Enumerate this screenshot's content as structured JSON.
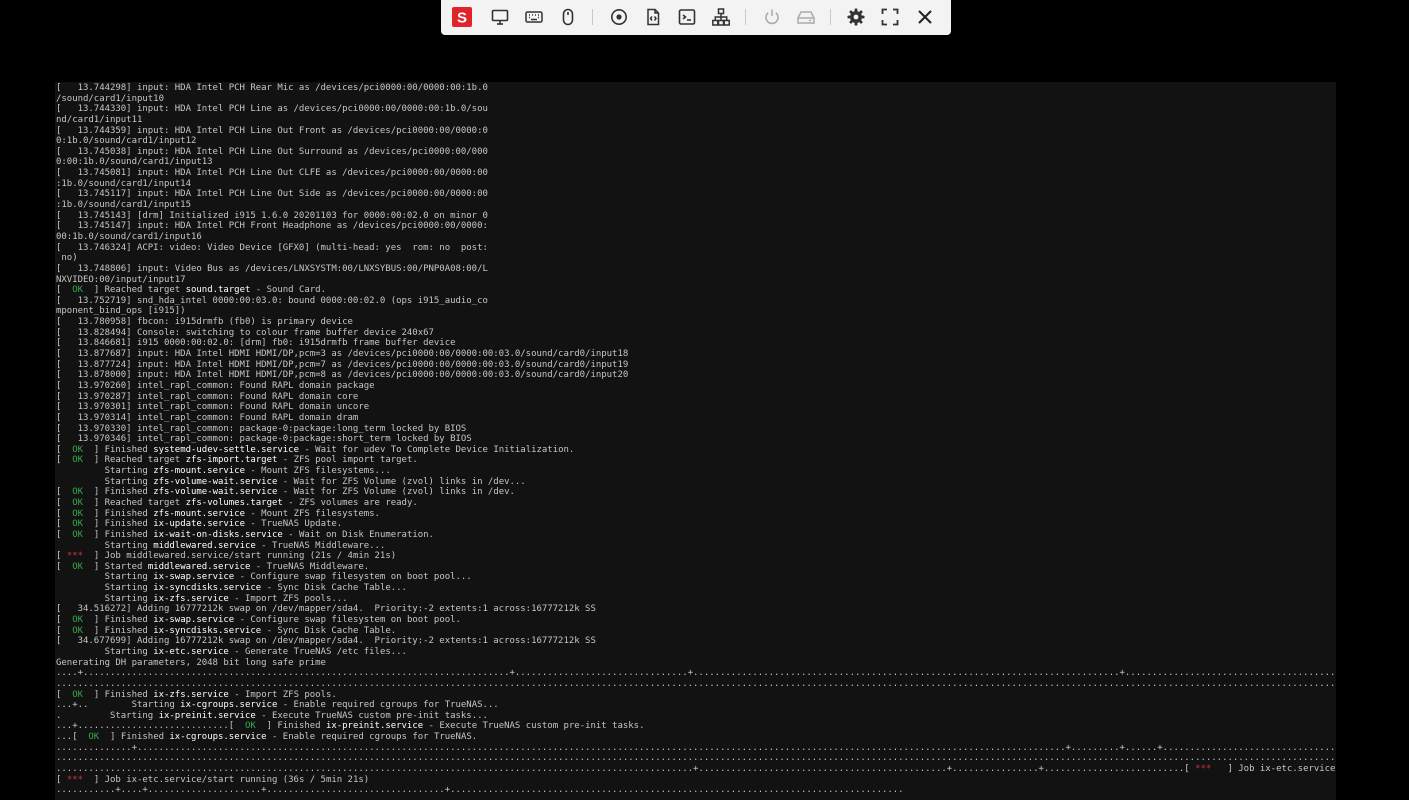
{
  "toolbar": {
    "logo_letter": "S",
    "brand_color": "#e0242b",
    "buttons": [
      {
        "name": "display-icon"
      },
      {
        "name": "keyboard-icon"
      },
      {
        "name": "mouse-icon"
      },
      {
        "name": "disc-icon"
      },
      {
        "name": "script-icon"
      },
      {
        "name": "terminal-icon"
      },
      {
        "name": "network-icon"
      },
      {
        "name": "power-icon"
      },
      {
        "name": "drive-icon"
      },
      {
        "name": "gear-icon"
      },
      {
        "name": "fullscreen-icon"
      },
      {
        "name": "close-icon"
      }
    ]
  },
  "console": {
    "colors": {
      "background": "#121212",
      "text": "#c6c6c6",
      "ok": "#35a84a",
      "star": "#c53a3a",
      "highlight": "#ffffff"
    },
    "lines": [
      [
        [
          "t",
          "[   13.744298] input: HDA Intel PCH Rear Mic as /devices/pci0000:00/0000:00:1b.0"
        ]
      ],
      [
        [
          "t",
          "/sound/card1/input10"
        ]
      ],
      [
        [
          "t",
          "[   13.744330] input: HDA Intel PCH Line as /devices/pci0000:00/0000:00:1b.0/sou"
        ]
      ],
      [
        [
          "t",
          "nd/card1/input11"
        ]
      ],
      [
        [
          "t",
          "[   13.744359] input: HDA Intel PCH Line Out Front as /devices/pci0000:00/0000:0"
        ]
      ],
      [
        [
          "t",
          "0:1b.0/sound/card1/input12"
        ]
      ],
      [
        [
          "t",
          "[   13.745038] input: HDA Intel PCH Line Out Surround as /devices/pci0000:00/000"
        ]
      ],
      [
        [
          "t",
          "0:00:1b.0/sound/card1/input13"
        ]
      ],
      [
        [
          "t",
          "[   13.745081] input: HDA Intel PCH Line Out CLFE as /devices/pci0000:00/0000:00"
        ]
      ],
      [
        [
          "t",
          ":1b.0/sound/card1/input14"
        ]
      ],
      [
        [
          "t",
          "[   13.745117] input: HDA Intel PCH Line Out Side as /devices/pci0000:00/0000:00"
        ]
      ],
      [
        [
          "t",
          ":1b.0/sound/card1/input15"
        ]
      ],
      [
        [
          "t",
          "[   13.745143] [drm] Initialized i915 1.6.0 20201103 for 0000:00:02.0 on minor 0"
        ]
      ],
      [
        [
          "t",
          "[   13.745147] input: HDA Intel PCH Front Headphone as /devices/pci0000:00/0000:"
        ]
      ],
      [
        [
          "t",
          "00:1b.0/sound/card1/input16"
        ]
      ],
      [
        [
          "t",
          "[   13.746324] ACPI: video: Video Device [GFX0] (multi-head: yes  rom: no  post:"
        ]
      ],
      [
        [
          "t",
          " no)"
        ]
      ],
      [
        [
          "t",
          "[   13.748806] input: Video Bus as /devices/LNXSYSTM:00/LNXSYBUS:00/PNP0A08:00/L"
        ]
      ],
      [
        [
          "t",
          "NXVIDEO:00/input/input17"
        ]
      ],
      [
        [
          "t",
          "[  "
        ],
        [
          "ok",
          "OK"
        ],
        [
          "t",
          "  ] Reached target "
        ],
        [
          "hl",
          "sound.target"
        ],
        [
          "t",
          " - Sound Card."
        ]
      ],
      [
        [
          "t",
          "[   13.752719] snd_hda_intel 0000:00:03.0: bound 0000:00:02.0 (ops i915_audio_co"
        ]
      ],
      [
        [
          "t",
          "mponent_bind_ops [i915])"
        ]
      ],
      [
        [
          "t",
          "[   13.780958] fbcon: i915drmfb (fb0) is primary device"
        ]
      ],
      [
        [
          "t",
          "[   13.828494] Console: switching to colour frame buffer device 240x67"
        ]
      ],
      [
        [
          "t",
          "[   13.846681] i915 0000:00:02.0: [drm] fb0: i915drmfb frame buffer device"
        ]
      ],
      [
        [
          "t",
          "[   13.877687] input: HDA Intel HDMI HDMI/DP,pcm=3 as /devices/pci0000:00/0000:00:03.0/sound/card0/input18"
        ]
      ],
      [
        [
          "t",
          "[   13.877724] input: HDA Intel HDMI HDMI/DP,pcm=7 as /devices/pci0000:00/0000:00:03.0/sound/card0/input19"
        ]
      ],
      [
        [
          "t",
          "[   13.878000] input: HDA Intel HDMI HDMI/DP,pcm=8 as /devices/pci0000:00/0000:00:03.0/sound/card0/input20"
        ]
      ],
      [
        [
          "t",
          "[   13.970260] intel_rapl_common: Found RAPL domain package"
        ]
      ],
      [
        [
          "t",
          "[   13.970287] intel_rapl_common: Found RAPL domain core"
        ]
      ],
      [
        [
          "t",
          "[   13.970301] intel_rapl_common: Found RAPL domain uncore"
        ]
      ],
      [
        [
          "t",
          "[   13.970314] intel_rapl_common: Found RAPL domain dram"
        ]
      ],
      [
        [
          "t",
          "[   13.970330] intel_rapl_common: package-0:package:long_term locked by BIOS"
        ]
      ],
      [
        [
          "t",
          "[   13.970346] intel_rapl_common: package-0:package:short_term locked by BIOS"
        ]
      ],
      [
        [
          "t",
          "[  "
        ],
        [
          "ok",
          "OK"
        ],
        [
          "t",
          "  ] Finished "
        ],
        [
          "hl",
          "systemd-udev-settle.service"
        ],
        [
          "t",
          " - Wait for udev To Complete Device Initialization."
        ]
      ],
      [
        [
          "t",
          "[  "
        ],
        [
          "ok",
          "OK"
        ],
        [
          "t",
          "  ] Reached target "
        ],
        [
          "hl",
          "zfs-import.target"
        ],
        [
          "t",
          " - ZFS pool import target."
        ]
      ],
      [
        [
          "t",
          "         Starting "
        ],
        [
          "hl",
          "zfs-mount.service"
        ],
        [
          "t",
          " - Mount ZFS filesystems..."
        ]
      ],
      [
        [
          "t",
          "         Starting "
        ],
        [
          "hl",
          "zfs-volume-wait.service"
        ],
        [
          "t",
          " - Wait for ZFS Volume (zvol) links in /dev..."
        ]
      ],
      [
        [
          "t",
          "[  "
        ],
        [
          "ok",
          "OK"
        ],
        [
          "t",
          "  ] Finished "
        ],
        [
          "hl",
          "zfs-volume-wait.service"
        ],
        [
          "t",
          " - Wait for ZFS Volume (zvol) links in /dev."
        ]
      ],
      [
        [
          "t",
          "[  "
        ],
        [
          "ok",
          "OK"
        ],
        [
          "t",
          "  ] Reached target "
        ],
        [
          "hl",
          "zfs-volumes.target"
        ],
        [
          "t",
          " - ZFS volumes are ready."
        ]
      ],
      [
        [
          "t",
          "[  "
        ],
        [
          "ok",
          "OK"
        ],
        [
          "t",
          "  ] Finished "
        ],
        [
          "hl",
          "zfs-mount.service"
        ],
        [
          "t",
          " - Mount ZFS filesystems."
        ]
      ],
      [
        [
          "t",
          "[  "
        ],
        [
          "ok",
          "OK"
        ],
        [
          "t",
          "  ] Finished "
        ],
        [
          "hl",
          "ix-update.service"
        ],
        [
          "t",
          " - TrueNAS Update."
        ]
      ],
      [
        [
          "t",
          "[  "
        ],
        [
          "ok",
          "OK"
        ],
        [
          "t",
          "  ] Finished "
        ],
        [
          "hl",
          "ix-wait-on-disks.service"
        ],
        [
          "t",
          " - Wait on Disk Enumeration."
        ]
      ],
      [
        [
          "t",
          "         Starting "
        ],
        [
          "hl",
          "middlewared.service"
        ],
        [
          "t",
          " - TrueNAS Middleware..."
        ]
      ],
      [
        [
          "t",
          "[ "
        ],
        [
          "star",
          "***"
        ],
        [
          "t",
          "  ] Job middlewared.service/start running (21s / 4min 21s)"
        ]
      ],
      [
        [
          "t",
          "[  "
        ],
        [
          "ok",
          "OK"
        ],
        [
          "t",
          "  ] Started "
        ],
        [
          "hl",
          "middlewared.service"
        ],
        [
          "t",
          " - TrueNAS Middleware."
        ]
      ],
      [
        [
          "t",
          "         Starting "
        ],
        [
          "hl",
          "ix-swap.service"
        ],
        [
          "t",
          " - Configure swap filesystem on boot pool..."
        ]
      ],
      [
        [
          "t",
          "         Starting "
        ],
        [
          "hl",
          "ix-syncdisks.service"
        ],
        [
          "t",
          " - Sync Disk Cache Table..."
        ]
      ],
      [
        [
          "t",
          "         Starting "
        ],
        [
          "hl",
          "ix-zfs.service"
        ],
        [
          "t",
          " - Import ZFS pools..."
        ]
      ],
      [
        [
          "t",
          "[   34.516272] Adding 16777212k swap on /dev/mapper/sda4.  Priority:-2 extents:1 across:16777212k SS"
        ]
      ],
      [
        [
          "t",
          "[  "
        ],
        [
          "ok",
          "OK"
        ],
        [
          "t",
          "  ] Finished "
        ],
        [
          "hl",
          "ix-swap.service"
        ],
        [
          "t",
          " - Configure swap filesystem on boot pool."
        ]
      ],
      [
        [
          "t",
          "[  "
        ],
        [
          "ok",
          "OK"
        ],
        [
          "t",
          "  ] Finished "
        ],
        [
          "hl",
          "ix-syncdisks.service"
        ],
        [
          "t",
          " - Sync Disk Cache Table."
        ]
      ],
      [
        [
          "t",
          "[   34.677699] Adding 16777212k swap on /dev/mapper/sda4.  Priority:-2 extents:1 across:16777212k SS"
        ]
      ],
      [
        [
          "t",
          "         Starting "
        ],
        [
          "hl",
          "ix-etc.service"
        ],
        [
          "t",
          " - Generate TrueNAS /etc files..."
        ]
      ],
      [
        [
          "t",
          "Generating DH parameters, 2048 bit long safe prime"
        ]
      ],
      [
        [
          "t",
          "....+...............................................................................+................................+...............................................................................+..........................................................................................+................................................"
        ]
      ],
      [
        [
          "t",
          "................................................................................................................................................................................................................................................................................................................................."
        ]
      ],
      [
        [
          "t",
          "[  "
        ],
        [
          "ok",
          "OK"
        ],
        [
          "t",
          "  ] Finished "
        ],
        [
          "hl",
          "ix-zfs.service"
        ],
        [
          "t",
          " - Import ZFS pools."
        ]
      ],
      [
        [
          "t",
          "...+..        Starting "
        ],
        [
          "hl",
          "ix-cgroups.service"
        ],
        [
          "t",
          " - Enable required cgroups for TrueNAS..."
        ]
      ],
      [
        [
          "t",
          ".         Starting "
        ],
        [
          "hl",
          "ix-preinit.service"
        ],
        [
          "t",
          " - Execute TrueNAS custom pre-init tasks..."
        ]
      ],
      [
        [
          "t",
          "...+............................[  "
        ],
        [
          "ok",
          "OK"
        ],
        [
          "t",
          "  ] Finished "
        ],
        [
          "hl",
          "ix-preinit.service"
        ],
        [
          "t",
          " - Execute TrueNAS custom pre-init tasks."
        ]
      ],
      [
        [
          "t",
          "...[  "
        ],
        [
          "ok",
          "OK"
        ],
        [
          "t",
          "  ] Finished "
        ],
        [
          "hl",
          "ix-cgroups.service"
        ],
        [
          "t",
          " - Enable required cgroups for TrueNAS."
        ]
      ],
      [
        [
          "t",
          "..............+............................................................................................................................................................................+.........+......+..............................................................."
        ]
      ],
      [
        [
          "t",
          "................................................................................................................................................................................................................................................................................................................................."
        ]
      ],
      [
        [
          "t",
          "......................................................................................................................+..............................................+................+..........................[ "
        ],
        [
          "star",
          "*** "
        ],
        [
          "t",
          "  ] Job ix-etc.service/start running"
        ]
      ],
      [
        [
          "t",
          "[ "
        ],
        [
          "star",
          "***"
        ],
        [
          "t",
          "  ] Job ix-etc.service/start running (36s / 5min 21s)"
        ]
      ],
      [
        [
          "t",
          "...........+....+.....................+.................................+...................................................................................."
        ]
      ]
    ]
  }
}
